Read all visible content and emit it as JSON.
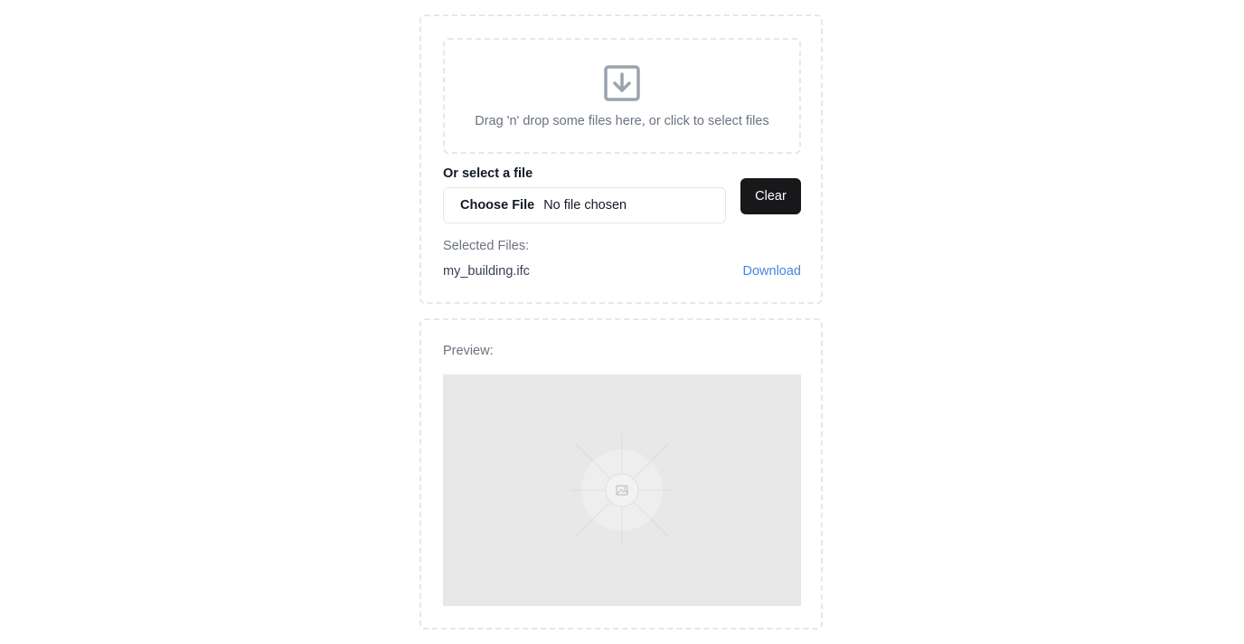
{
  "upload": {
    "dropzone": {
      "icon": "download-box-icon",
      "text": "Drag 'n' drop some files here, or click to select files"
    },
    "select_label": "Or select a file",
    "file_input": {
      "button_label": "Choose File",
      "status": "No file chosen"
    },
    "clear_label": "Clear",
    "selected_heading": "Selected Files:",
    "files": [
      {
        "name": "my_building.ifc",
        "action": "Download"
      }
    ]
  },
  "preview": {
    "label": "Preview:",
    "placeholder_icon": "image-placeholder-icon"
  },
  "colors": {
    "primary_button": "#18181b",
    "link": "#4a86d4",
    "muted_text": "#6b7280",
    "dashed_border": "#e5e7eb",
    "preview_bg": "#e8e8e8"
  }
}
